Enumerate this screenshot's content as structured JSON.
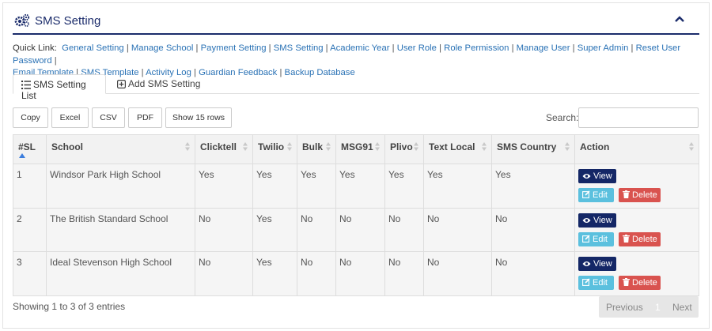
{
  "header": {
    "title": "SMS Setting"
  },
  "quick_links": {
    "label": "Quick Link:",
    "items": [
      "General Setting",
      "Manage School",
      "Payment Setting",
      "SMS Setting",
      "Academic Year",
      "User Role",
      "Role Permission",
      "Manage User",
      "Super Admin",
      "Reset User Password",
      "Email Template",
      "SMS Template",
      "Activity Log",
      "Guardian Feedback",
      "Backup Database"
    ]
  },
  "tabs": {
    "list": "SMS Setting List",
    "add": "Add SMS Setting"
  },
  "buttons": {
    "copy": "Copy",
    "excel": "Excel",
    "csv": "CSV",
    "pdf": "PDF",
    "show": "Show 15 rows"
  },
  "search": {
    "label": "Search:",
    "value": ""
  },
  "table": {
    "headers": [
      "#SL",
      "School",
      "Clicktell",
      "Twilio",
      "Bulk",
      "MSG91",
      "Plivo",
      "Text Local",
      "SMS Country",
      "Action"
    ],
    "rows": [
      [
        "1",
        "Windsor Park High School",
        "Yes",
        "Yes",
        "Yes",
        "Yes",
        "Yes",
        "Yes",
        "Yes"
      ],
      [
        "2",
        "The British Standard School",
        "No",
        "Yes",
        "No",
        "No",
        "No",
        "No",
        "No"
      ],
      [
        "3",
        "Ideal Stevenson High School",
        "No",
        "Yes",
        "No",
        "No",
        "No",
        "No",
        "No"
      ]
    ],
    "actions": {
      "view": "View",
      "edit": "Edit",
      "delete": "Delete"
    }
  },
  "footer": {
    "info": "Showing 1 to 3 of 3 entries",
    "previous": "Previous",
    "page": "1",
    "next": "Next"
  },
  "colors": {
    "primary": "#1b2c6b",
    "link": "#2a72b5",
    "view": "#142766",
    "edit": "#5bc0de",
    "delete": "#d9534f"
  }
}
